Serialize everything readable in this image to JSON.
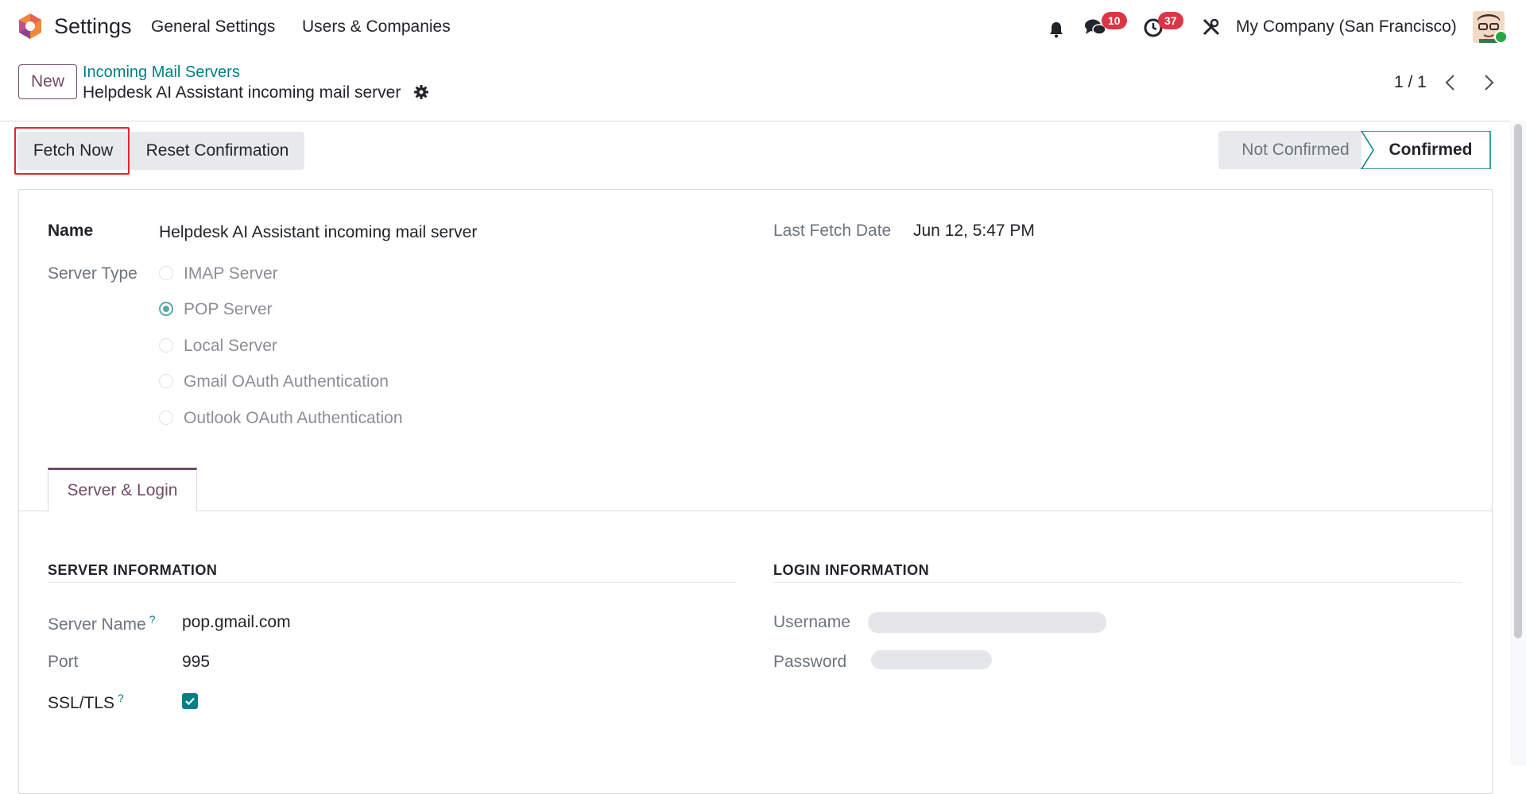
{
  "navbar": {
    "app_name": "Settings",
    "menu": [
      "General Settings",
      "Users & Companies"
    ],
    "messages_count": "10",
    "activities_count": "37",
    "company": "My Company (San Francisco)"
  },
  "control_panel": {
    "new_label": "New",
    "breadcrumb_parent": "Incoming Mail Servers",
    "breadcrumb_current": "Helpdesk AI Assistant incoming mail server",
    "pager": "1 / 1"
  },
  "statusbar": {
    "fetch_label": "Fetch Now",
    "reset_label": "Reset Confirmation",
    "states": [
      "Not Confirmed",
      "Confirmed"
    ],
    "active_state": "Confirmed"
  },
  "form": {
    "name_label": "Name",
    "name_value": "Helpdesk AI Assistant incoming mail server",
    "last_fetch_label": "Last Fetch Date",
    "last_fetch_value": "Jun 12, 5:47 PM",
    "server_type_label": "Server Type",
    "server_types": [
      "IMAP Server",
      "POP Server",
      "Local Server",
      "Gmail OAuth Authentication",
      "Outlook OAuth Authentication"
    ],
    "selected_server_type": "POP Server"
  },
  "tab": {
    "label": "Server & Login"
  },
  "server_info": {
    "title": "SERVER INFORMATION",
    "server_name_label": "Server Name",
    "server_name_value": "pop.gmail.com",
    "port_label": "Port",
    "port_value": "995",
    "ssl_label": "SSL/TLS",
    "ssl_checked": true,
    "help_mark": "?"
  },
  "login_info": {
    "title": "LOGIN INFORMATION",
    "username_label": "Username",
    "password_label": "Password"
  },
  "colors": {
    "brand": "#714B67",
    "accent": "#017e84",
    "badge": "#dc3545"
  }
}
